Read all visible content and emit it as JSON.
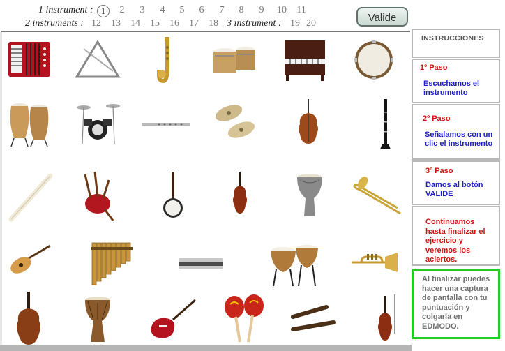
{
  "header": {
    "row1_label": "1 instrument :",
    "row2_label": "2 instruments :",
    "row2b_label": "3 instrument :",
    "row1_numbers": [
      "1",
      "2",
      "3",
      "4",
      "5",
      "6",
      "7",
      "8",
      "9",
      "10",
      "11"
    ],
    "row2_numbers": [
      "12",
      "13",
      "14",
      "15",
      "16",
      "17",
      "18"
    ],
    "row2b_numbers": [
      "19",
      "20"
    ],
    "current": "1",
    "valide_label": "Valide"
  },
  "instruments": [
    "accordion-icon",
    "triangle-icon",
    "saxophone-icon",
    "bongo-icon",
    "piano-icon",
    "tambourine-icon",
    "conga-icon",
    "drum-kit-icon",
    "flute-icon",
    "cymbals-icon",
    "cello-icon",
    "clarinet-icon",
    "recorder-icon",
    "bagpipes-icon",
    "banjo-icon",
    "violin-icon",
    "darbuka-icon",
    "trombone-icon",
    "guitar-icon",
    "pan-flute-icon",
    "harmonica-icon",
    "timpani-icon",
    "trumpet-icon",
    "",
    "double-bass-icon",
    "djembe-icon",
    "electric-guitar-icon",
    "maracas-icon",
    "claves-icon",
    "violin-small-icon"
  ],
  "sidebar": {
    "title": "INSTRUCCIONES",
    "step1_title": "1º Paso",
    "step1_text": "Escuchamos el instrumento",
    "step2_title": "2º Paso",
    "step2_text": "Señalamos con un clic el instrumento",
    "step3_title": "3º Paso",
    "step3_text": "Damos al botón VALIDE",
    "continue_text": "Continuamos hasta finalizar el ejercicio y veremos los aciertos.",
    "final_text": "Al finalizar puedes hacer una captura de pantalla con tu puntuación y colgarla en EDMODO."
  },
  "colors": {
    "red": "#d21212",
    "blue": "#1d1dcc",
    "green_border": "#22cc22",
    "gray_border": "#b8b8b8"
  }
}
